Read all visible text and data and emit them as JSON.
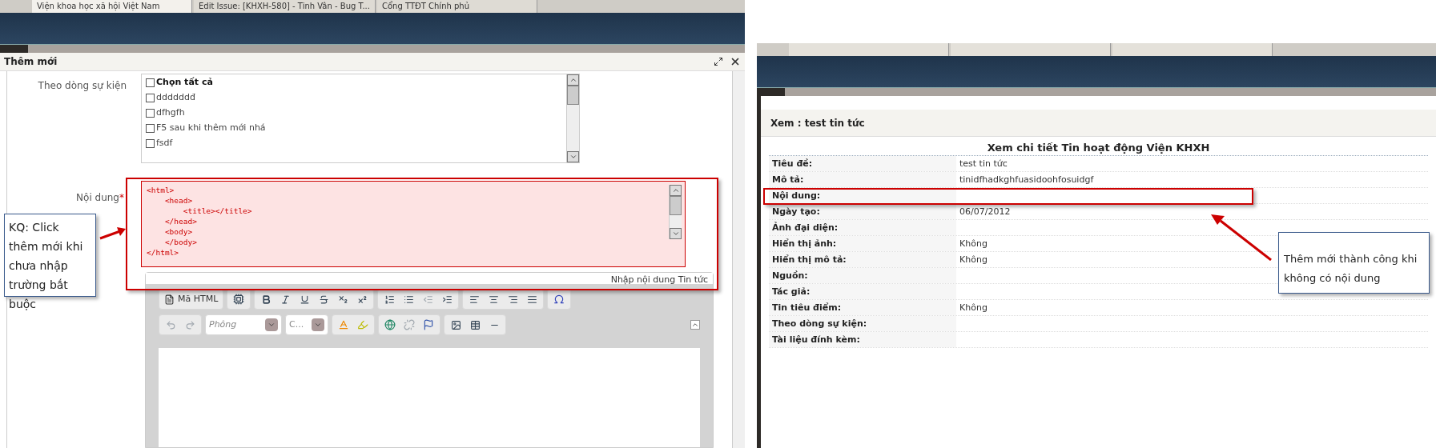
{
  "left_window": {
    "browser_tabs": [
      {
        "title": "Viện khoa học xã hội Việt Nam",
        "selected": true
      },
      {
        "title": "Edit Issue: [KHXH-580] - Tinh Vân - Bug T...",
        "selected": false
      },
      {
        "title": "Cổng TTĐT Chính phủ",
        "selected": false
      }
    ],
    "dialog": {
      "title": "Thêm mới",
      "event_field": {
        "label": "Theo dòng sự kiện",
        "items": [
          {
            "label": "Chọn tất cả",
            "checked": false,
            "kind": "all"
          },
          {
            "label": "ddddddđ",
            "checked": false,
            "kind": "item"
          },
          {
            "label": "dfhgfh",
            "checked": false,
            "kind": "item"
          },
          {
            "label": "F5 sau khi thêm mới nhá",
            "checked": false,
            "kind": "item"
          },
          {
            "label": "fsdf",
            "checked": false,
            "kind": "item"
          }
        ]
      },
      "content_field": {
        "label": "Nội dung",
        "required_mark": "*",
        "code": "<html>\n\t<head>\n\t\t<title></title>\n\t</head>\n\t<body>\n\t</body>\n</html>",
        "hint": "Nhập nội dung Tin tức",
        "html_button": "Mã HTML",
        "font_select": "Phông",
        "size_select": "C..."
      }
    }
  },
  "right_window": {
    "dialog": {
      "title": "Xem : test tin tức",
      "heading": "Xem chi tiết Tin hoạt động Viện KHXH",
      "rows": [
        {
          "label": "Tiêu đề:",
          "value": "test tin tức"
        },
        {
          "label": "Mô tả:",
          "value": "tinidfhadkghfuasidoohfosuidgf"
        },
        {
          "label": "Nội dung:"
        },
        {
          "label": "Ngày tạo:",
          "value": "06/07/2012"
        },
        {
          "label": "Ảnh đại diện:"
        },
        {
          "label": "Hiển thị ảnh:",
          "value": "Không"
        },
        {
          "label": "Hiển thị mô tả:",
          "value": "Không"
        },
        {
          "label": "Nguồn:"
        },
        {
          "label": "Tác giả:"
        },
        {
          "label": "Tin tiêu điểm:",
          "value": "Không"
        },
        {
          "label": "Theo dòng sự kiện:"
        },
        {
          "label": "Tài liệu đính kèm:"
        }
      ]
    }
  },
  "annotations": [
    {
      "text": "KQ: Click thêm mới khi chưa nhập trường bắt buộc"
    },
    {
      "text": "Thêm mới thành công khi không có nội dung"
    }
  ]
}
